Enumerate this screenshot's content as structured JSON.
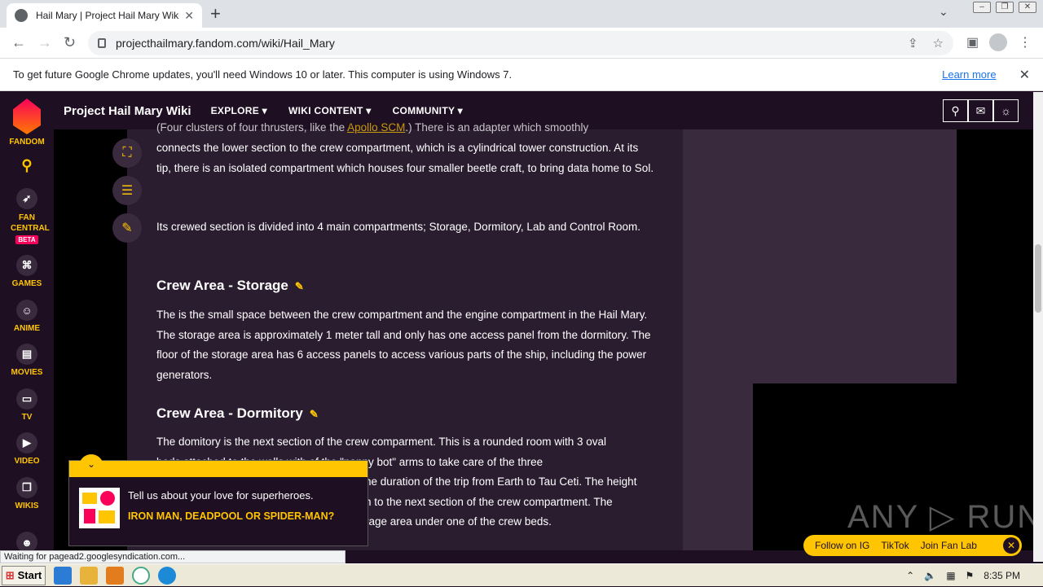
{
  "browser": {
    "tab_title": "Hail Mary | Project Hail Mary Wiki | F",
    "tab_close": "✕",
    "new_tab": "+",
    "tab_menu": "⌄",
    "url": "projecthailmary.fandom.com/wiki/Hail_Mary",
    "back": "←",
    "forward": "→",
    "reload": "↻"
  },
  "infobar": {
    "message": "To get future Google Chrome updates, you'll need Windows 10 or later. This computer is using Windows 7.",
    "learn_more": "Learn more",
    "close": "✕"
  },
  "rail": {
    "fandom": "FANDOM",
    "fan_central": "FAN CENTRAL",
    "beta": "BETA",
    "games": "GAMES",
    "anime": "ANIME",
    "movies": "MOVIES",
    "tv": "TV",
    "video": "VIDEO",
    "wikis": "WIKIS"
  },
  "nav": {
    "wiki_title": "Project Hail Mary Wiki",
    "explore": "EXPLORE ▾",
    "wiki_content": "WIKI CONTENT ▾",
    "community": "COMMUNITY ▾"
  },
  "article": {
    "p1_pre": "(Four clusters of four thrusters, like the ",
    "p1_link": "Apollo SCM",
    "p1_post": ".) There is an adapter which smoothly connects the lower section to the crew compartment, which is a cylindrical tower construction. At its tip, there is an isolated compartment which houses four smaller beetle craft, to bring data home to Sol.",
    "p2": "Its crewed section is divided into 4 main compartments; Storage, Dormitory, Lab and Control Room.",
    "h_storage": "Crew Area - Storage",
    "p_storage": "The is the small space between the crew compartment and the engine compartment in the Hail Mary. The storage area is approximately 1 meter tall and only has one access panel from the dormitory. The floor of the storage area has 6 access panels to access various parts of the ship, including the power generators.",
    "h_dorm": "Crew Area - Dormitory",
    "p_dorm_1": "The domitory is the next section of the crew comparment. This is a rounded room with 3 oval",
    "p_dorm_2": "beds attached to the walls with ",
    "p_dorm_2b": "of the \"nanny bot\" arms to take care of the three",
    "p_dorm_3": "he duration of the trip from Earth to Tau Ceti. The height",
    "p_dorm_4": "h to the next section of the crew compartment. The",
    "p_dorm_5": "rage area under one of the crew beds."
  },
  "popup": {
    "question": "Tell us about your love for superheroes.",
    "answer": "IRON MAN, DEADPOOL OR SPIDER-MAN?"
  },
  "status": "Waiting for pagead2.googlesyndication.com...",
  "social": {
    "ig": "Follow on IG",
    "tiktok": "TikTok",
    "fanlab": "Join Fan Lab"
  },
  "watermark": "ANY ▷ RUN",
  "taskbar": {
    "start": "Start",
    "time": "8:35 PM"
  }
}
